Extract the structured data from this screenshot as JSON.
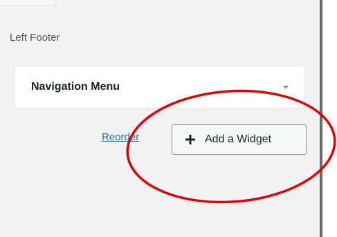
{
  "sidebar_area": {
    "title": "Left Footer",
    "widgets": [
      {
        "label": "Navigation Menu"
      }
    ],
    "reorder_label": "Reorder",
    "add_widget_label": "Add a Widget"
  },
  "icons": {
    "add": "plus-icon",
    "toggle": "chevron-down-icon"
  },
  "colors": {
    "link": "#2271b1",
    "annotation": "#e00000",
    "panel_background": "#f2f2f2"
  }
}
